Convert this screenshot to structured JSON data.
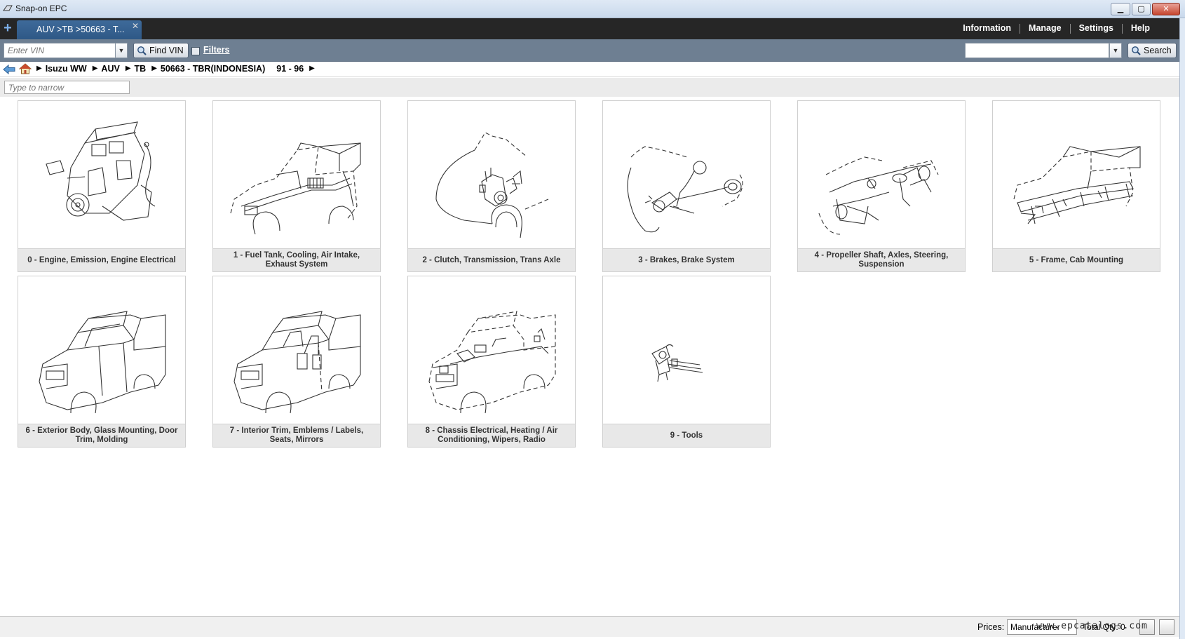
{
  "window": {
    "title": "Snap-on EPC",
    "btn_min": "▁",
    "btn_max": "▢",
    "btn_close": "✕"
  },
  "tabs": {
    "add": "+",
    "active_label": "AUV >TB >50663 - T...",
    "close": "✕"
  },
  "menu": {
    "information": "Information",
    "manage": "Manage",
    "settings": "Settings",
    "help": "Help"
  },
  "toolbar": {
    "vin_placeholder": "Enter VIN",
    "find_vin": "Find VIN",
    "filters": "Filters",
    "search": "Search",
    "dd": "▼"
  },
  "breadcrumb": {
    "arrow": "▶",
    "items": [
      "Isuzu WW",
      "AUV",
      "TB",
      "50663 - TBR(INDONESIA)",
      "91 - 96"
    ]
  },
  "narrow": {
    "placeholder": "Type to narrow"
  },
  "categories": [
    {
      "label": "0 - Engine, Emission, Engine Electrical",
      "icon": "engine-illustration"
    },
    {
      "label": "1 - Fuel Tank, Cooling, Air Intake, Exhaust System",
      "icon": "fuel-system-illustration"
    },
    {
      "label": "2 - Clutch, Transmission, Trans Axle",
      "icon": "transmission-illustration"
    },
    {
      "label": "3 - Brakes, Brake System",
      "icon": "brake-illustration"
    },
    {
      "label": "4 - Propeller Shaft, Axles, Steering, Suspension",
      "icon": "axle-illustration"
    },
    {
      "label": "5 - Frame, Cab Mounting",
      "icon": "frame-illustration"
    },
    {
      "label": "6 - Exterior Body, Glass Mounting, Door Trim, Molding",
      "icon": "exterior-body-illustration"
    },
    {
      "label": "7 - Interior Trim, Emblems / Labels, Seats, Mirrors",
      "icon": "interior-trim-illustration"
    },
    {
      "label": "8 - Chassis Electrical, Heating / Air Conditioning, Wipers, Radio",
      "icon": "chassis-electrical-illustration"
    },
    {
      "label": "9 - Tools",
      "icon": "tools-illustration"
    }
  ],
  "status": {
    "prices_label": "Prices:",
    "prices_value": "Manufacturer",
    "total": "Total Qty: 0"
  },
  "watermark": "www.epcatalogs.com"
}
